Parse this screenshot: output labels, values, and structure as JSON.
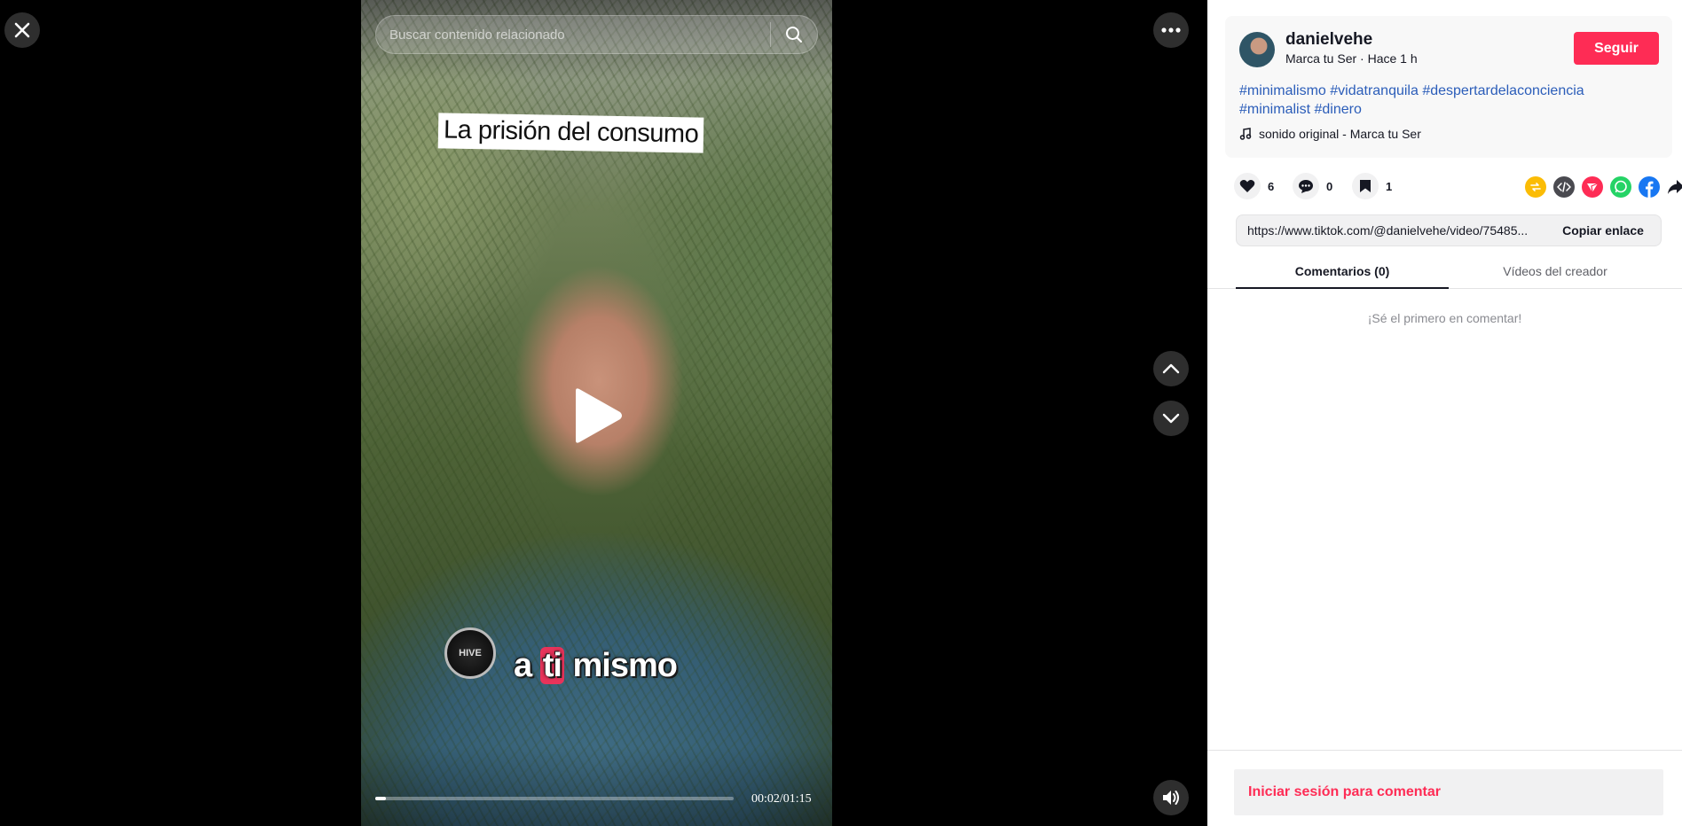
{
  "player": {
    "search": {
      "placeholder": "Buscar contenido relacionado"
    },
    "video": {
      "title_caption": "La prisión del consumo",
      "subtitle_caption": {
        "before": "a ",
        "highlight": "ti",
        "after": " mismo"
      },
      "watermark_text": "HIVE",
      "time": "00:02/01:15",
      "progress_fraction": 0.03
    },
    "icons": {
      "close": "close-icon",
      "more": "more-icon",
      "prev": "chevron-up-icon",
      "next": "chevron-down-icon",
      "volume": "volume-icon",
      "play": "play-icon",
      "search": "search-icon"
    }
  },
  "panel": {
    "author": {
      "username": "danielvehe",
      "meta": "Marca tu Ser · Hace 1 h",
      "follow_label": "Seguir"
    },
    "hashtags": [
      "#minimalismo",
      "#vidatranquila",
      "#despertardelaconciencia",
      "#minimalist",
      "#dinero"
    ],
    "music": "sonido original - Marca tu Ser",
    "stats": {
      "likes": "6",
      "comments": "0",
      "saves": "1"
    },
    "share_icons": [
      "repost-icon",
      "embed-icon",
      "send-icon",
      "whatsapp-icon",
      "facebook-icon",
      "share-arrow-icon"
    ],
    "link": {
      "url": "https://www.tiktok.com/@danielvehe/video/75485...",
      "copy_label": "Copiar enlace"
    },
    "tabs": {
      "comments": "Comentarios (0)",
      "videos": "Vídeos del creador"
    },
    "empty_comments": "¡Sé el primero en comentar!",
    "login_comment": "Iniciar sesión para comentar"
  },
  "colors": {
    "accent": "#fe2c55",
    "hashtag": "#2b5db9",
    "repost": "#fbbc05",
    "embed": "#4a4a50",
    "send": "#fe2c55",
    "whatsapp": "#25d366",
    "facebook": "#1877f2"
  }
}
